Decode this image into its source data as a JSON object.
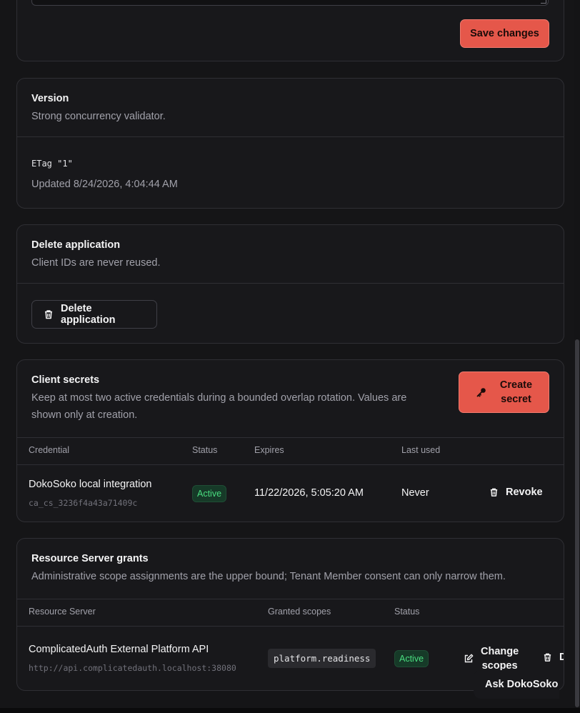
{
  "settings_card": {
    "save_label": "Save changes"
  },
  "version_card": {
    "title": "Version",
    "description": "Strong concurrency validator.",
    "etag": "ETag \"1\"",
    "updated": "Updated 8/24/2026, 4:04:44 AM"
  },
  "delete_card": {
    "title": "Delete application",
    "description": "Client IDs are never reused.",
    "button_label": "Delete application"
  },
  "secrets_card": {
    "title": "Client secrets",
    "description": "Keep at most two active credentials during a bounded overlap rotation. Values are shown only at creation.",
    "create_label_line1": "Create",
    "create_label_line2": "secret",
    "columns": [
      "Credential",
      "Status",
      "Expires",
      "Last used"
    ],
    "rows": [
      {
        "name": "DokoSoko local integration",
        "id": "ca_cs_3236f4a43a71409c",
        "status": "Active",
        "expires": "11/22/2026, 5:05:20 AM",
        "last_used": "Never",
        "action": "Revoke"
      }
    ]
  },
  "grants_card": {
    "title": "Resource Server grants",
    "description": "Administrative scope assignments are the upper bound; Tenant Member consent can only narrow them.",
    "columns": [
      "Resource Server",
      "Granted scopes",
      "Status"
    ],
    "rows": [
      {
        "name": "ComplicatedAuth External Platform API",
        "url": "http://api.complicatedauth.localhost:38080",
        "scope": "platform.readiness",
        "status": "Active",
        "change_line1": "Change",
        "change_line2": "scopes",
        "delete_partial": "D"
      }
    ]
  },
  "assistant": {
    "label": "Ask DokoSoko"
  },
  "colors": {
    "accent": "#e5574a",
    "active_badge_bg": "#163a28",
    "active_badge_text": "#4ade80"
  }
}
